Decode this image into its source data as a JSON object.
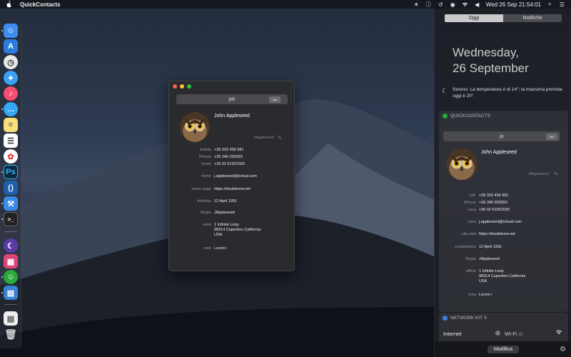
{
  "menubar": {
    "app_name": "QuickContacts",
    "datetime": "Wed 26 Sep  21:54:01"
  },
  "window": {
    "search_value": "joh",
    "contact": {
      "name": "John Appleseed",
      "nickname": "JAppleseed",
      "fields": [
        {
          "label": "mobile",
          "value": "+39 333 456 981"
        },
        {
          "label": "iPhone",
          "value": "+39 340 393993"
        },
        {
          "label": "home",
          "value": "+39 02 61922020"
        },
        {
          "label": "home",
          "value": "j.appleseed@icloud.com"
        },
        {
          "label": "home page",
          "value": "https://doublerew.net"
        },
        {
          "label": "birthday",
          "value": "12 April 1991"
        },
        {
          "label": "Skype",
          "value": "JAppleseed"
        },
        {
          "label": "work",
          "value": "1 Infinite Loop\n95014 Cupertino California\nUSA"
        },
        {
          "label": "note",
          "value": "Lorem i"
        }
      ]
    }
  },
  "notification_center": {
    "tabs": [
      "Oggi",
      "Notifiche"
    ],
    "weekday": "Wednesday,",
    "day_month": "26 September",
    "weather_text": "Sereno. La temperatura è di 14°; la massima prevista oggi è 20°.",
    "quickcontacts": {
      "title": "QUICKCONTACTS",
      "search_value": "jo",
      "name": "John Appleseed",
      "nickname": "JAppleseed",
      "fields": [
        {
          "label": "cell.",
          "value": "+39 333 456 981"
        },
        {
          "label": "iPhone",
          "value": "+39 340 393993"
        },
        {
          "label": "casa",
          "value": "+39 02 61922020"
        },
        {
          "label": "casa",
          "value": "j.appleseed@icloud.com"
        },
        {
          "label": "sito web",
          "value": "https://doublerew.net"
        },
        {
          "label": "compleanno",
          "value": "12 April 1991"
        },
        {
          "label": "Skype",
          "value": "JAppleseed"
        },
        {
          "label": "ufficio",
          "value": "1 Infinite Loop\n95014 Cupertino California\nUSA"
        },
        {
          "label": "nota",
          "value": "Lorem i"
        }
      ]
    },
    "network": {
      "title": "NETWORK KIT X",
      "label": "Internet",
      "value": "Wi-Fi ◇"
    },
    "edit_button": "Modifica"
  },
  "colors": {
    "accent": "#2aaa3a",
    "window_bg": "#2a2b2e"
  }
}
